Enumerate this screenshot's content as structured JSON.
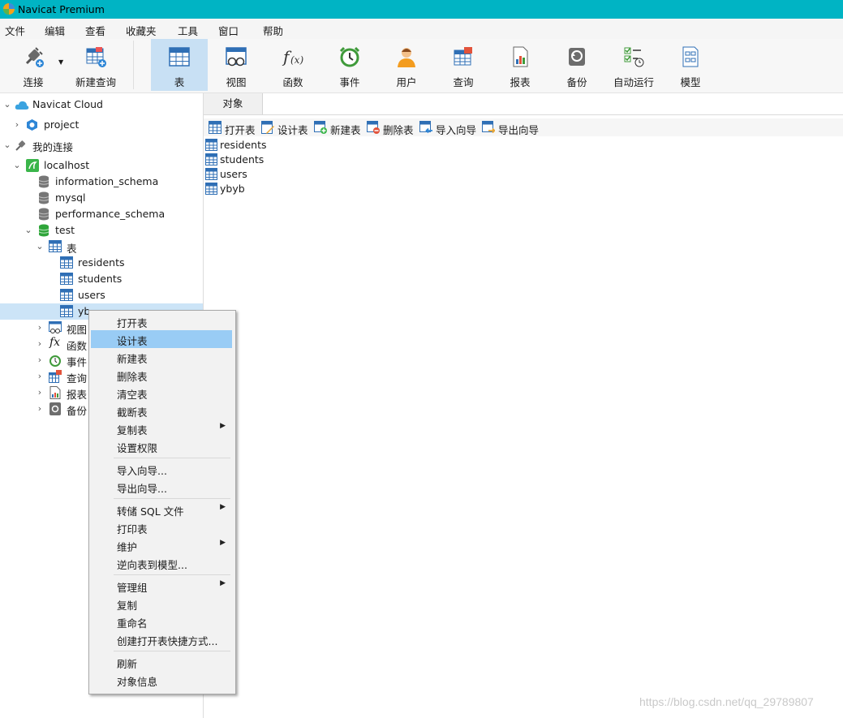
{
  "window": {
    "title": "Navicat Premium"
  },
  "menu": [
    "文件",
    "编辑",
    "查看",
    "收藏夹",
    "工具",
    "窗口",
    "帮助"
  ],
  "toolbar": {
    "connect": "连接",
    "new_query": "新建查询",
    "table": "表",
    "view": "视图",
    "function": "函数",
    "event": "事件",
    "user": "用户",
    "query": "查询",
    "report": "报表",
    "backup": "备份",
    "auto_run": "自动运行",
    "model": "模型"
  },
  "tree": {
    "navicat_cloud": "Navicat Cloud",
    "project": "project",
    "my_connections": "我的连接",
    "localhost": "localhost",
    "databases": [
      "information_schema",
      "mysql",
      "performance_schema",
      "test"
    ],
    "tables_group": "表",
    "tables": [
      "residents",
      "students",
      "users",
      "ybyb"
    ],
    "selected_table_partial": "yb",
    "views": "视图",
    "functions": "函数",
    "events": "事件",
    "queries": "查询",
    "reports": "报表",
    "backups": "备份"
  },
  "tab": {
    "objects": "对象"
  },
  "object_toolbar": {
    "open": "打开表",
    "design": "设计表",
    "new": "新建表",
    "delete": "删除表",
    "import": "导入向导",
    "export": "导出向导"
  },
  "object_list": [
    "residents",
    "students",
    "users",
    "ybyb"
  ],
  "context_menu": {
    "open_table": "打开表",
    "design_table": "设计表",
    "new_table": "新建表",
    "delete_table": "删除表",
    "empty_table": "清空表",
    "truncate_table": "截断表",
    "copy_table": "复制表",
    "set_permissions": "设置权限",
    "import_wizard": "导入向导...",
    "export_wizard": "导出向导...",
    "dump_sql": "转储 SQL 文件",
    "print_table": "打印表",
    "maintain": "维护",
    "reverse_to_model": "逆向表到模型...",
    "manage_group": "管理组",
    "copy": "复制",
    "rename": "重命名",
    "create_shortcut": "创建打开表快捷方式...",
    "refresh": "刷新",
    "object_info": "对象信息"
  },
  "watermark": "https://blog.csdn.net/qq_29789807",
  "colors": {
    "titlebar": "#00b4c4",
    "active_tool": "#c8e0f4",
    "menu_highlight": "#99ccf5",
    "selection": "#cce4f7"
  }
}
